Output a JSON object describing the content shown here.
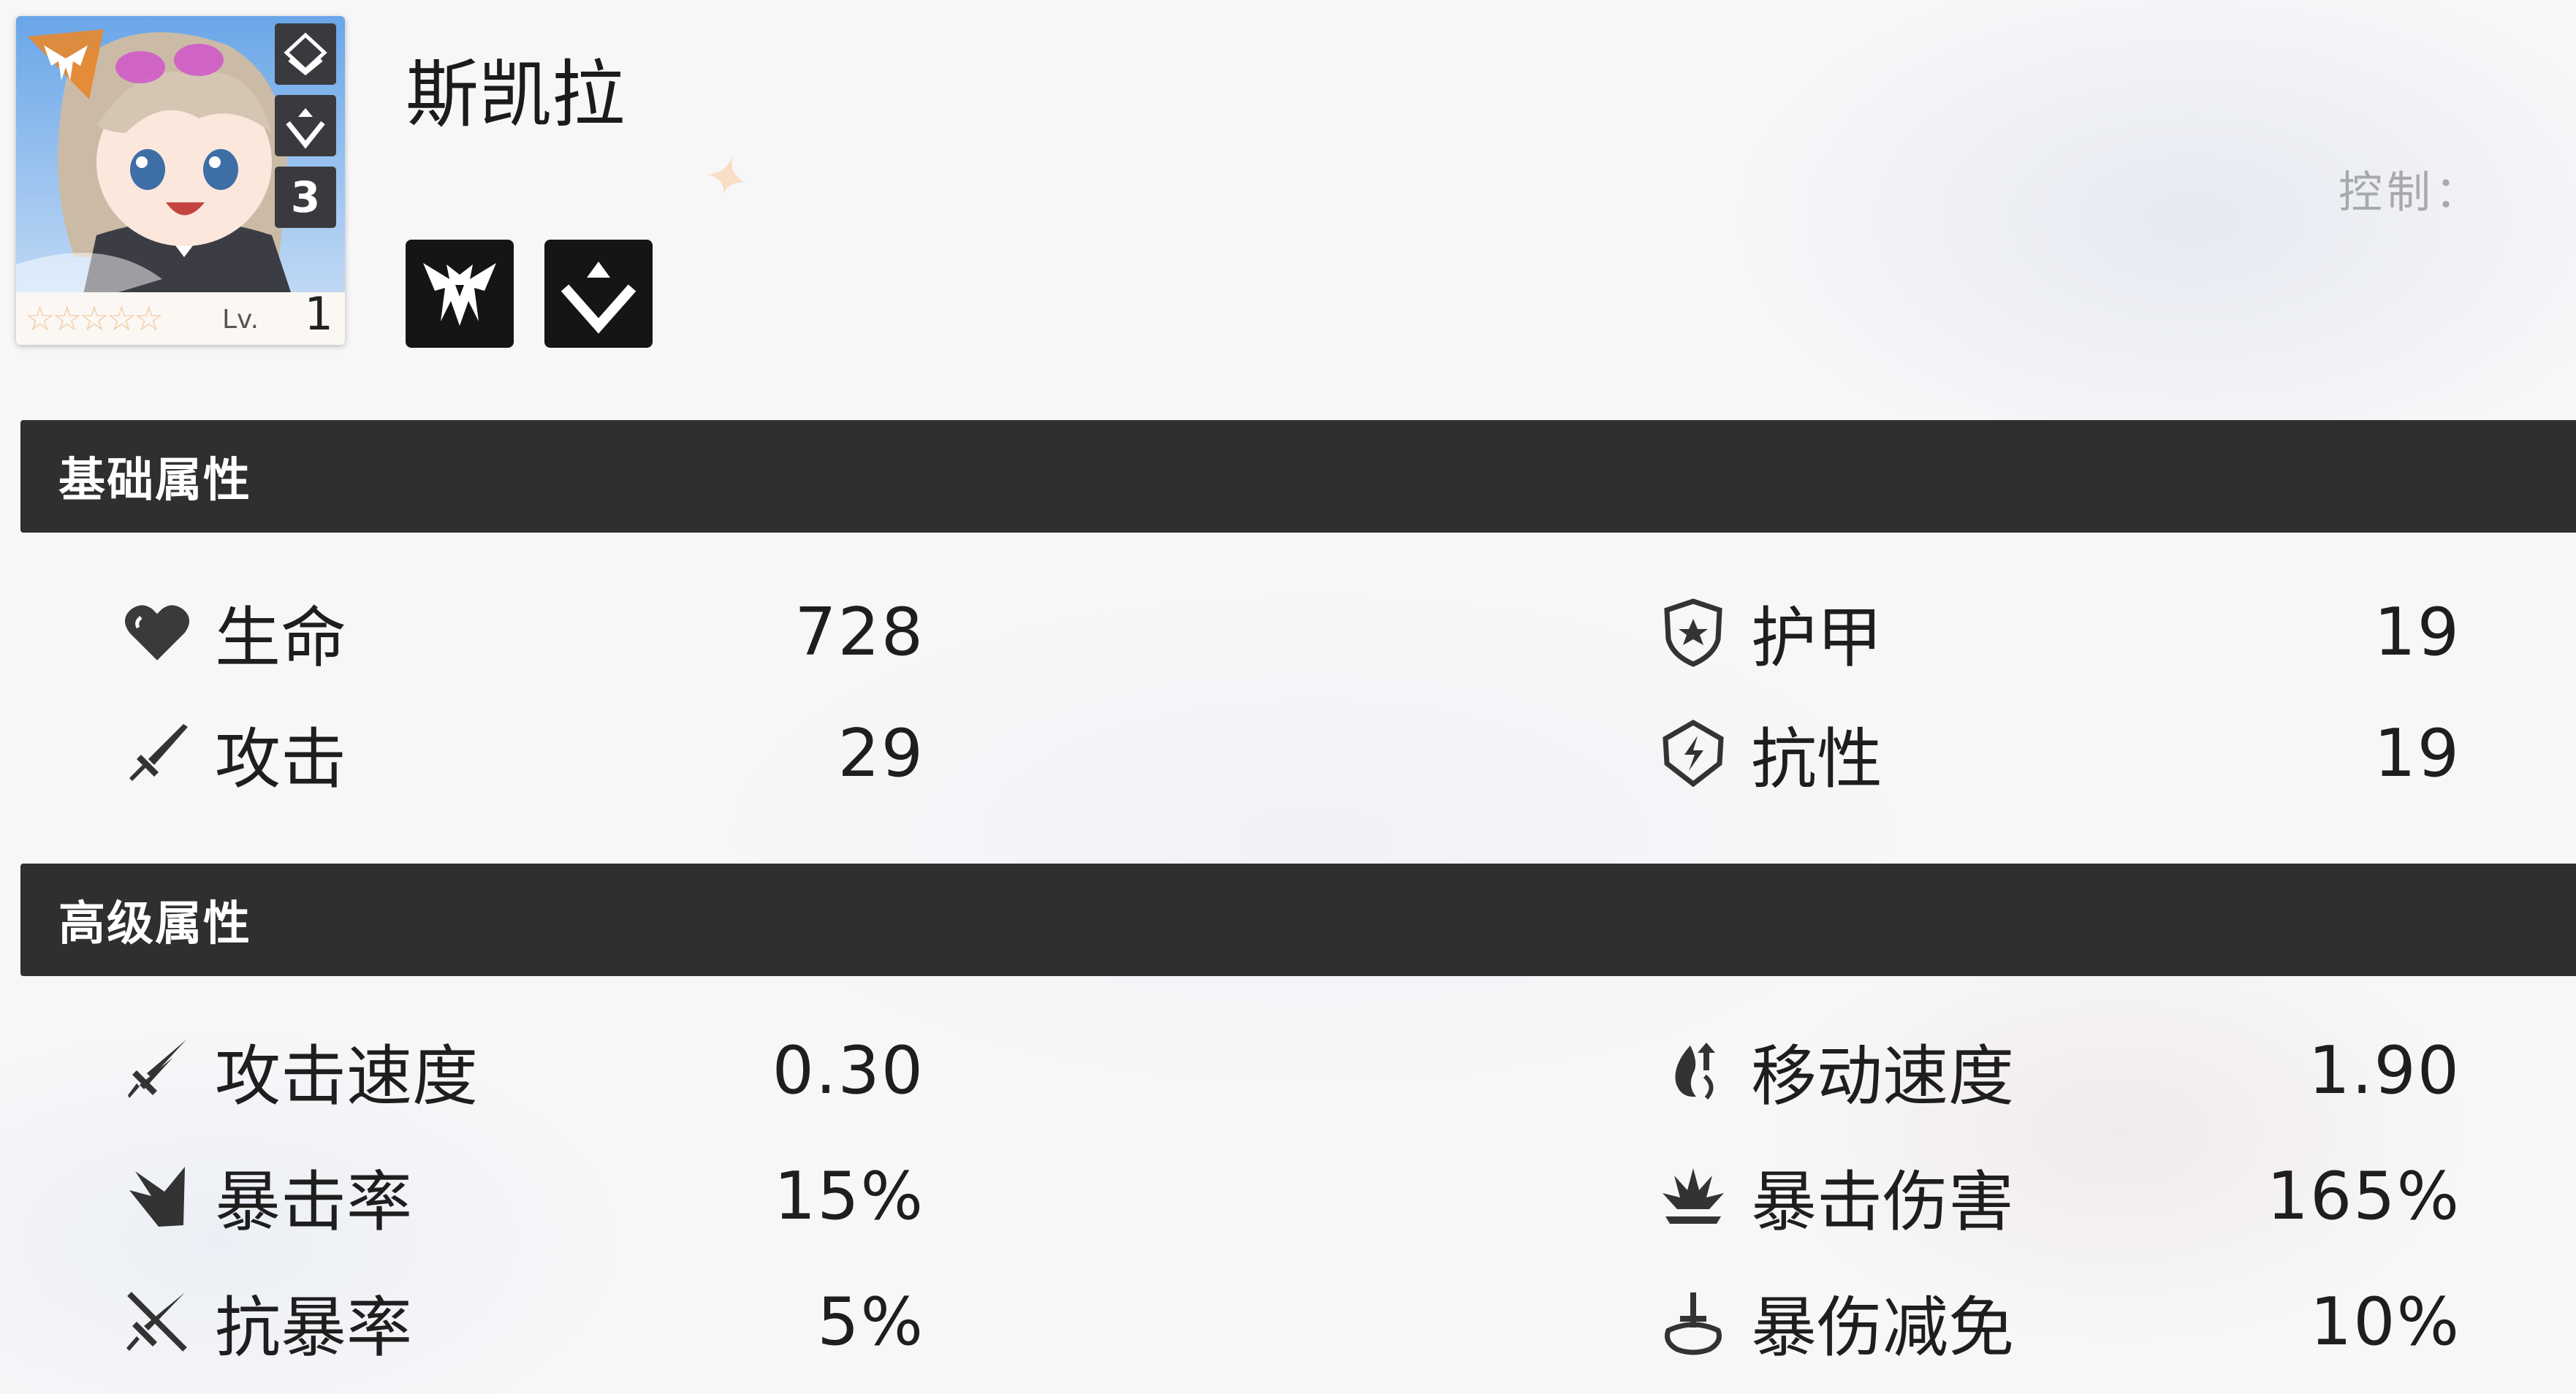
{
  "character": {
    "name": "斯凯拉",
    "level_label": "Lv.",
    "level": "1",
    "rank": "3",
    "stars_display": "☆☆☆☆☆",
    "star_count": 0,
    "portrait_icon": "character-portrait",
    "class_icon": "winged-emblem-icon",
    "type_icon": "chevron-diamond-icon"
  },
  "faded_text": "控制：",
  "sections": {
    "basic": {
      "title": "基础属性",
      "stats": [
        {
          "label": "生命",
          "value": "728",
          "icon": "heart-icon"
        },
        {
          "label": "护甲",
          "value": "19",
          "icon": "shield-icon"
        },
        {
          "label": "攻击",
          "value": "29",
          "icon": "sword-icon"
        },
        {
          "label": "抗性",
          "value": "19",
          "icon": "resist-shield-icon"
        }
      ]
    },
    "advanced": {
      "title": "高级属性",
      "stats": [
        {
          "label": "攻击速度",
          "value": "0.30",
          "icon": "attack-speed-icon"
        },
        {
          "label": "移动速度",
          "value": "1.90",
          "icon": "move-speed-icon"
        },
        {
          "label": "暴击率",
          "value": "15%",
          "icon": "crit-rate-icon"
        },
        {
          "label": "暴击伤害",
          "value": "165%",
          "icon": "crit-damage-icon"
        },
        {
          "label": "抗暴率",
          "value": "5%",
          "icon": "crit-resist-icon"
        },
        {
          "label": "暴伤减免",
          "value": "10%",
          "icon": "crit-damage-reduction-icon"
        }
      ]
    }
  },
  "colors": {
    "section_bar": "#2f2f2f",
    "icon_tile": "#151515",
    "text": "#1e1e1e",
    "accent_orange": "#e8872c",
    "star_outline": "#f1c9a2"
  }
}
